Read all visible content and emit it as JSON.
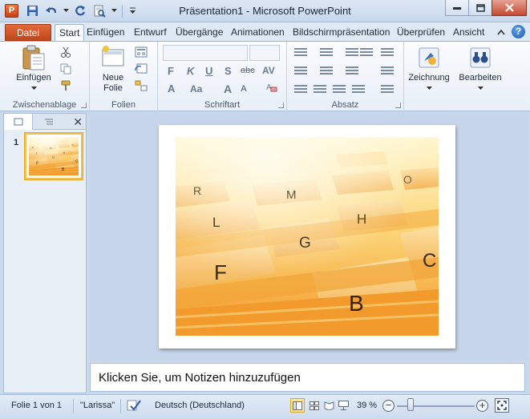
{
  "app": {
    "icon_letter": "P",
    "window_title": "Präsentation1 - Microsoft PowerPoint"
  },
  "quick_access": [
    "save-icon",
    "undo-icon",
    "redo-icon",
    "print-preview-icon",
    "customize-qat-icon"
  ],
  "tabs": [
    {
      "label": "Datei"
    },
    {
      "label": "Start"
    },
    {
      "label": "Einfügen"
    },
    {
      "label": "Entwurf"
    },
    {
      "label": "Übergänge"
    },
    {
      "label": "Animationen"
    },
    {
      "label": "Bildschirmpräsentation"
    },
    {
      "label": "Überprüfen"
    },
    {
      "label": "Ansicht"
    }
  ],
  "ribbon": {
    "clipboard": {
      "paste_label": "Einfügen",
      "group_label": "Zwischenablage"
    },
    "slides": {
      "new_slide_line1": "Neue",
      "new_slide_line2": "Folie",
      "group_label": "Folien"
    },
    "font": {
      "font_name_value": "",
      "font_size_value": "",
      "bold": "F",
      "italic": "K",
      "underline": "U",
      "strike": "S",
      "shadow": "abc",
      "spacing": "AV",
      "font_color": "A",
      "case": "Aa",
      "grow": "A",
      "shrink": "A",
      "group_label": "Schriftart"
    },
    "paragraph": {
      "group_label": "Absatz"
    },
    "drawing": {
      "label": "Zeichnung"
    },
    "editing": {
      "label": "Bearbeiten"
    }
  },
  "left_pane": {
    "slide_number": "1"
  },
  "notes": {
    "placeholder": "Klicken Sie, um Notizen hinzuzufügen"
  },
  "status": {
    "slide_info": "Folie 1 von 1",
    "theme": "\"Larissa\"",
    "language": "Deutsch (Deutschland)",
    "zoom": "39 %",
    "zoom_level_percent": 39
  },
  "slide_content": {
    "image_desc_letters": [
      "R",
      "M",
      "O",
      "L",
      "G",
      "H",
      "F",
      "B",
      "C"
    ]
  },
  "colors": {
    "file_tab": "#c9461c",
    "ribbon_bg": "#f3f7fc",
    "accent": "#2b579a"
  }
}
